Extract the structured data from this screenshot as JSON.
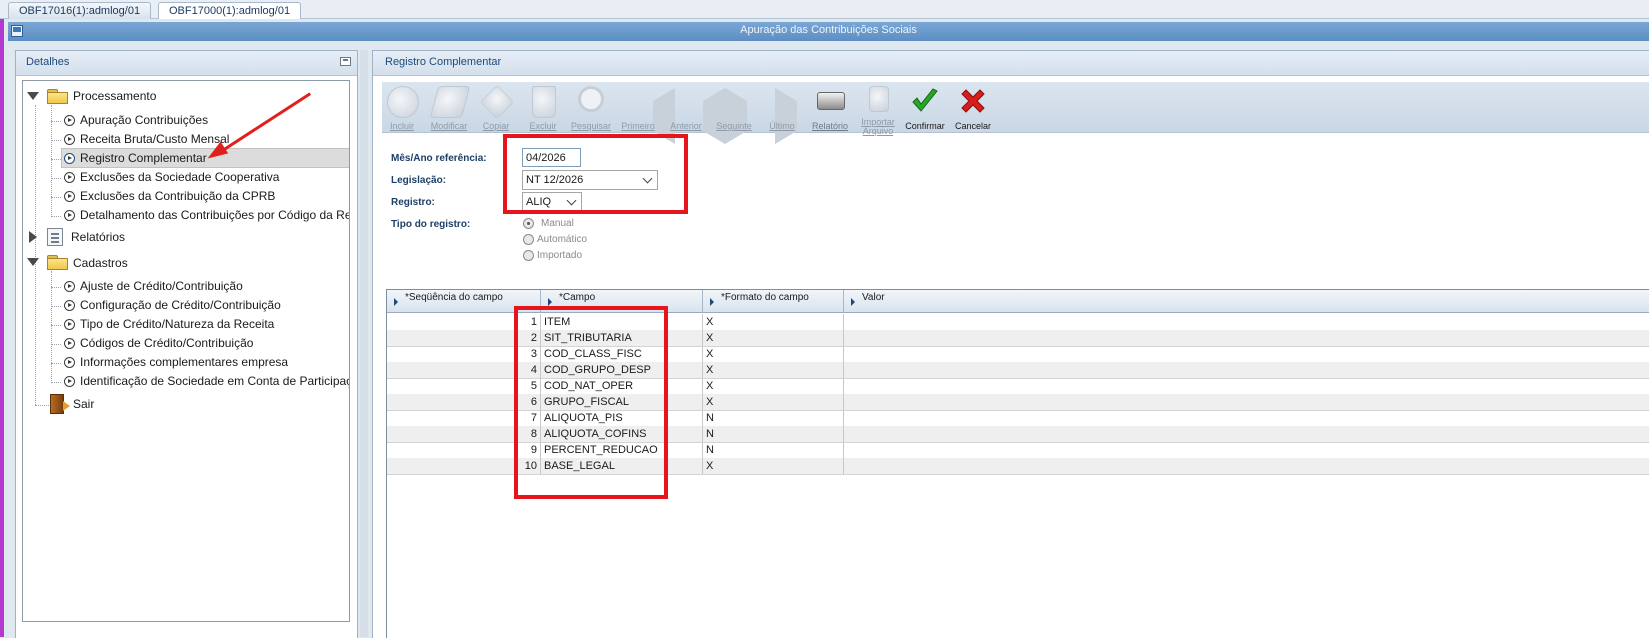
{
  "tabs": [
    "OBF17016(1):admlog/01",
    "OBF17000(1):admlog/01"
  ],
  "window": {
    "title": "Apuração das Contribuições Sociais"
  },
  "left_panel": {
    "title": "Detalhes",
    "tree": {
      "processamento": {
        "label": "Processamento",
        "items": [
          "Apuração Contribuições",
          "Receita Bruta/Custo Mensal",
          "Registro Complementar",
          "Exclusões da Sociedade Cooperativa",
          "Exclusões da Contribuição da CPRB",
          "Detalhamento das Contribuições por Código da Rece"
        ],
        "selected_index": 2
      },
      "relatorios": {
        "label": "Relatórios"
      },
      "cadastros": {
        "label": "Cadastros",
        "items": [
          "Ajuste de Crédito/Contribuição",
          "Configuração de Crédito/Contribuição",
          "Tipo de Crédito/Natureza da Receita",
          "Códigos de Crédito/Contribuição",
          "Informações complementares empresa",
          "Identificação de Sociedade em Conta de Participação"
        ]
      },
      "sair": {
        "label": "Sair"
      }
    }
  },
  "right_panel": {
    "title": "Registro Complementar",
    "toolbar": [
      {
        "label": "Incluir",
        "icon": "add-document-icon",
        "enabled": false
      },
      {
        "label": "Modificar",
        "icon": "edit-pencil-icon",
        "enabled": false
      },
      {
        "label": "Copiar",
        "icon": "copy-pages-icon",
        "enabled": false
      },
      {
        "label": "Excluir",
        "icon": "trash-can-icon",
        "enabled": false
      },
      {
        "label": "Pesquisar",
        "icon": "magnifier-icon",
        "enabled": false
      },
      {
        "label": "Primeiro",
        "icon": "first-arrow-icon",
        "enabled": false
      },
      {
        "label": "Anterior",
        "icon": "previous-arrow-icon",
        "enabled": false
      },
      {
        "label": "Seguinte",
        "icon": "next-arrow-icon",
        "enabled": false
      },
      {
        "label": "Último",
        "icon": "last-arrow-icon",
        "enabled": false
      },
      {
        "label": "Relatório",
        "icon": "printer-icon",
        "enabled": false
      },
      {
        "label": "Importar Arquivo",
        "icon": "import-file-icon",
        "enabled": false
      },
      {
        "label": "Confirmar",
        "icon": "green-check-icon",
        "enabled": true
      },
      {
        "label": "Cancelar",
        "icon": "red-x-icon",
        "enabled": true
      }
    ],
    "form": {
      "mes_ano_label": "Mês/Ano referência:",
      "mes_ano_value": "04/2026",
      "legislacao_label": "Legislação:",
      "legislacao_value": "NT 12/2026",
      "registro_label": "Registro:",
      "registro_value": "ALIQ",
      "tipo_label": "Tipo do registro:",
      "tipo_options": [
        "Manual",
        "Automático",
        "Importado"
      ],
      "tipo_selected": 0
    },
    "grid": {
      "columns": [
        "*Seqüência do campo",
        "*Campo",
        "*Formato do campo",
        "Valor"
      ],
      "rows": [
        {
          "seq": "1",
          "campo": "ITEM",
          "formato": "X",
          "valor": ""
        },
        {
          "seq": "2",
          "campo": "SIT_TRIBUTARIA",
          "formato": "X",
          "valor": ""
        },
        {
          "seq": "3",
          "campo": "COD_CLASS_FISC",
          "formato": "X",
          "valor": ""
        },
        {
          "seq": "4",
          "campo": "COD_GRUPO_DESP",
          "formato": "X",
          "valor": ""
        },
        {
          "seq": "5",
          "campo": "COD_NAT_OPER",
          "formato": "X",
          "valor": ""
        },
        {
          "seq": "6",
          "campo": "GRUPO_FISCAL",
          "formato": "X",
          "valor": ""
        },
        {
          "seq": "7",
          "campo": "ALIQUOTA_PIS",
          "formato": "N",
          "valor": ""
        },
        {
          "seq": "8",
          "campo": "ALIQUOTA_COFINS",
          "formato": "N",
          "valor": ""
        },
        {
          "seq": "9",
          "campo": "PERCENT_REDUCAO",
          "formato": "N",
          "valor": ""
        },
        {
          "seq": "10",
          "campo": "BASE_LEGAL",
          "formato": "X",
          "valor": ""
        }
      ]
    }
  },
  "colors": {
    "title_bar": "#5d8ec3",
    "highlight_red": "#e6141b",
    "label_blue": "#1e3f66",
    "confirm_green": "#2aa52a",
    "cancel_red": "#d81d1d"
  }
}
